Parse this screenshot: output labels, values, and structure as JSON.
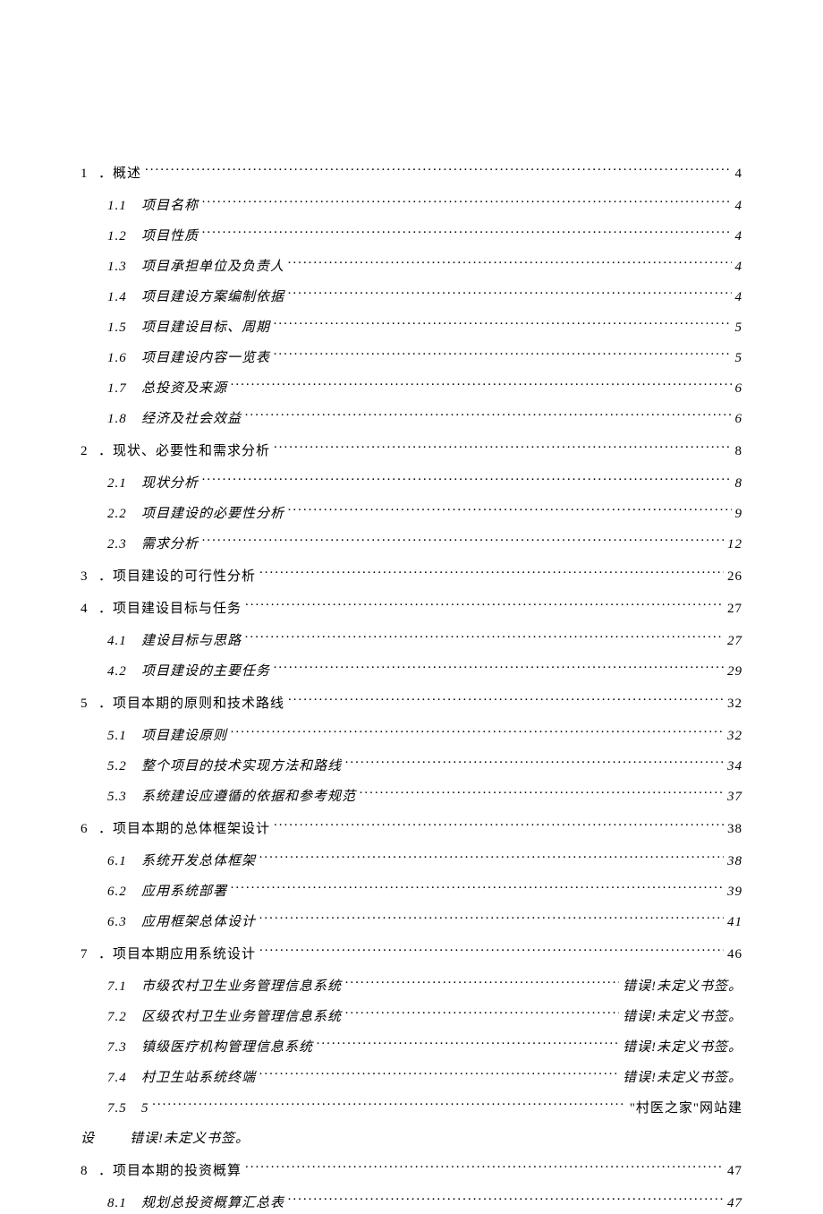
{
  "toc": {
    "error_text": "错误!未定义书签。",
    "sections": [
      {
        "num": "1",
        "title": "．概述",
        "page": "4",
        "level": 1,
        "items": [
          {
            "num": "1.1",
            "title": "项目名称",
            "page": "4"
          },
          {
            "num": "1.2",
            "title": "项目性质",
            "page": "4"
          },
          {
            "num": "1.3",
            "title": "项目承担单位及负责人",
            "page": "4"
          },
          {
            "num": "1.4",
            "title": "项目建设方案编制依据",
            "page": "4"
          },
          {
            "num": "1.5",
            "title": "项目建设目标、周期",
            "page": "5"
          },
          {
            "num": "1.6",
            "title": "项目建设内容一览表",
            "page": "5"
          },
          {
            "num": "1.7",
            "title": "总投资及来源",
            "page": "6"
          },
          {
            "num": "1.8",
            "title": "经济及社会效益",
            "page": "6"
          }
        ]
      },
      {
        "num": "2",
        "title": "．现状、必要性和需求分析",
        "page": "8",
        "level": 1,
        "items": [
          {
            "num": "2.1",
            "title": "现状分析",
            "page": "8"
          },
          {
            "num": "2.2",
            "title": "项目建设的必要性分析",
            "page": "9"
          },
          {
            "num": "2.3",
            "title": "需求分析",
            "page": "12"
          }
        ]
      },
      {
        "num": "3",
        "title": "．项目建设的可行性分析",
        "page": "26",
        "level": 1,
        "items": []
      },
      {
        "num": "4",
        "title": "．项目建设目标与任务",
        "page": "27",
        "level": 1,
        "items": [
          {
            "num": "4.1",
            "title": "建设目标与思路",
            "page": "27"
          },
          {
            "num": "4.2",
            "title": "项目建设的主要任务",
            "page": "29"
          }
        ]
      },
      {
        "num": "5",
        "title": "．项目本期的原则和技术路线",
        "page": "32",
        "level": 1,
        "items": [
          {
            "num": "5.1",
            "title": "项目建设原则",
            "page": "32"
          },
          {
            "num": "5.2",
            "title": "整个项目的技术实现方法和路线",
            "page": "34"
          },
          {
            "num": "5.3",
            "title": "系统建设应遵循的依据和参考规范",
            "page": "37"
          }
        ]
      },
      {
        "num": "6",
        "title": "．项目本期的总体框架设计",
        "page": "38",
        "level": 1,
        "items": [
          {
            "num": "6.1",
            "title": "系统开发总体框架",
            "page": "38"
          },
          {
            "num": "6.2",
            "title": "应用系统部署",
            "page": "39"
          },
          {
            "num": "6.3",
            "title": "应用框架总体设计",
            "page": "41"
          }
        ]
      },
      {
        "num": "7",
        "title": "．项目本期应用系统设计",
        "page": "46",
        "level": 1,
        "items": [
          {
            "num": "7.1",
            "title": "市级农村卫生业务管理信息系统",
            "page": "错误!未定义书签。"
          },
          {
            "num": "7.2",
            "title": "区级农村卫生业务管理信息系统",
            "page": "错误!未定义书签。"
          },
          {
            "num": "7.3",
            "title": "镇级医疗机构管理信息系统",
            "page": "错误!未定义书签。"
          },
          {
            "num": "7.4",
            "title": "村卫生站系统终端",
            "page": "错误!未定义书签。"
          }
        ],
        "special_75": {
          "num": "7.5",
          "line1_title": "5",
          "line1_right": "\"村医之家\"网站建",
          "line2_left": "设",
          "line2_right": "错误!未定义书签。"
        }
      },
      {
        "num": "8",
        "title": "．项目本期的投资概算",
        "page": "47",
        "level": 1,
        "items": [
          {
            "num": "8.1",
            "title": "规划总投资概算汇总表",
            "page": "47"
          }
        ]
      }
    ]
  }
}
